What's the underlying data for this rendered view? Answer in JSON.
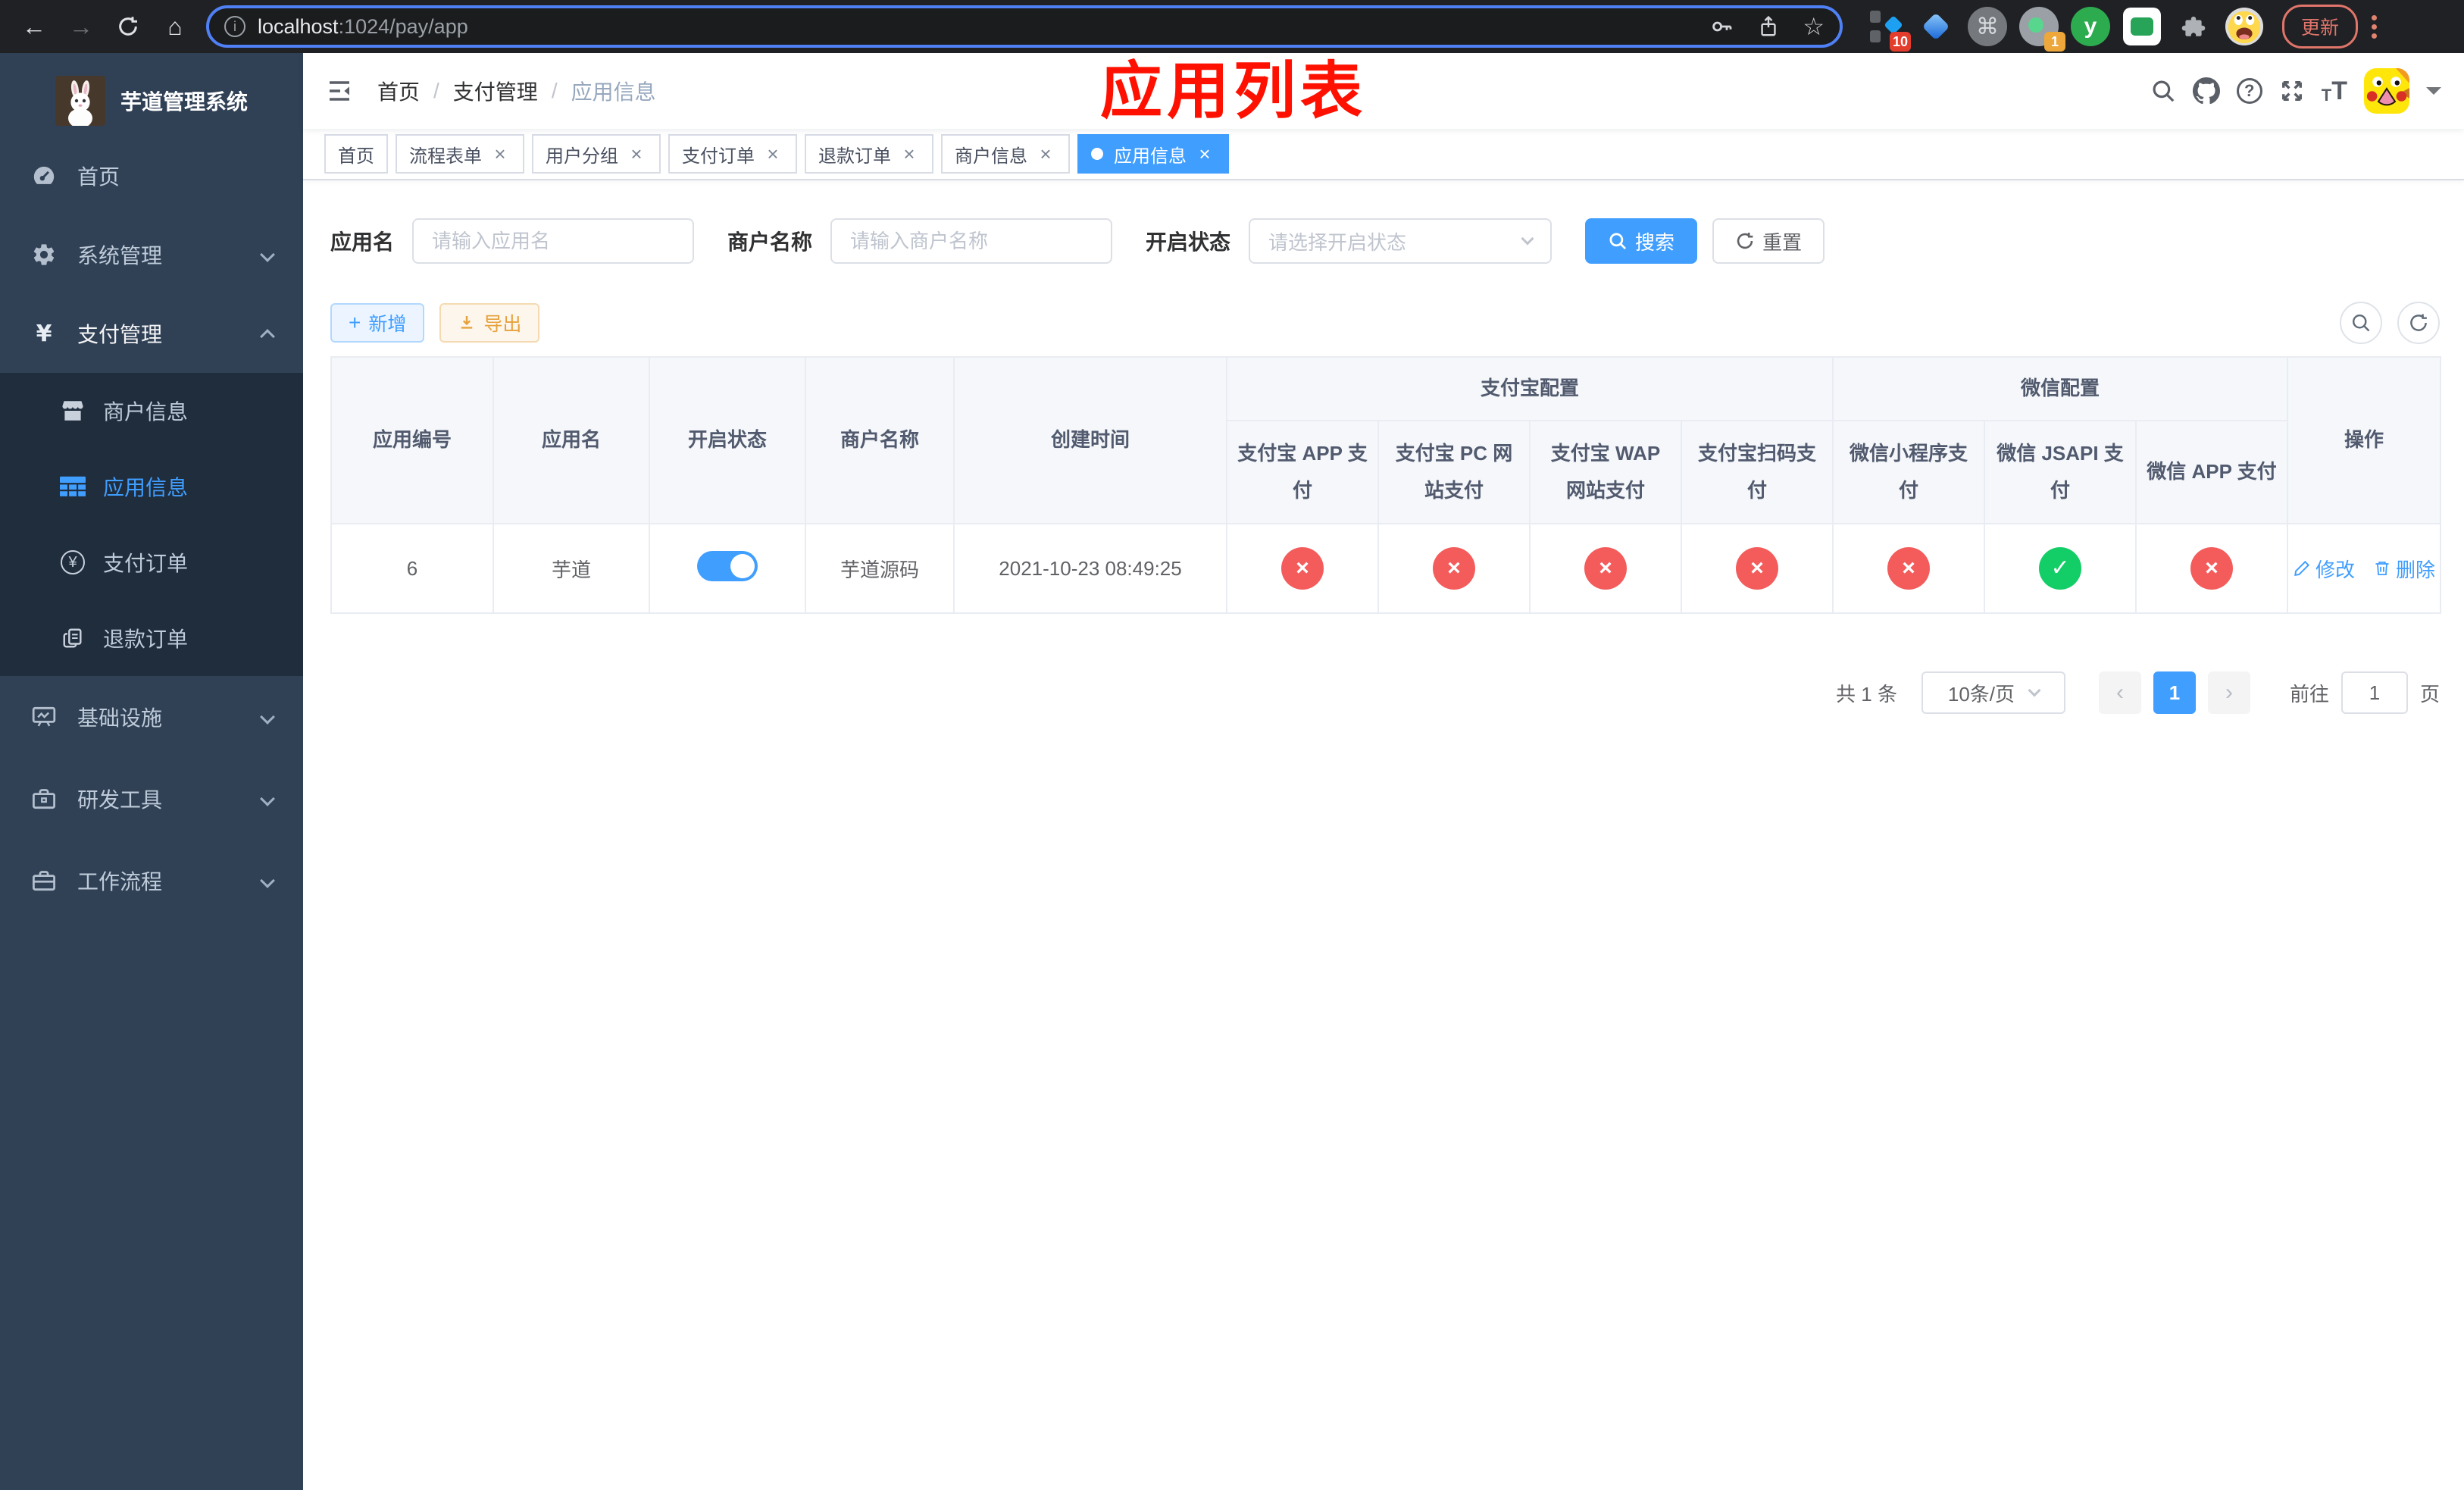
{
  "browser": {
    "url_domain": "localhost",
    "url_path": ":1024/pay/app",
    "update_label": "更新",
    "ext_badges": {
      "diamond": "10",
      "record": "1"
    },
    "ext_letter": "y"
  },
  "icons": {
    "back": "←",
    "forward": "→",
    "home": "⌂",
    "star": "☆",
    "command": "⌘",
    "info": "i",
    "question": "?",
    "yen": "¥",
    "plus": "+",
    "close": "×",
    "check": "✓",
    "cross": "×",
    "prev": "‹",
    "next": "›",
    "t_small": "T",
    "t_large": "T",
    "active_dot": ""
  },
  "sidebar": {
    "title": "芋道管理系统",
    "items": [
      {
        "label": "首页"
      },
      {
        "label": "系统管理"
      },
      {
        "label": "支付管理"
      },
      {
        "label": "商户信息"
      },
      {
        "label": "应用信息"
      },
      {
        "label": "支付订单"
      },
      {
        "label": "退款订单"
      },
      {
        "label": "基础设施"
      },
      {
        "label": "研发工具"
      },
      {
        "label": "工作流程"
      }
    ]
  },
  "header": {
    "breadcrumb": [
      "首页",
      "支付管理",
      "应用信息"
    ]
  },
  "annotation": {
    "title": "应用列表"
  },
  "tabs": [
    {
      "label": "首页"
    },
    {
      "label": "流程表单"
    },
    {
      "label": "用户分组"
    },
    {
      "label": "支付订单"
    },
    {
      "label": "退款订单"
    },
    {
      "label": "商户信息"
    },
    {
      "label": "应用信息"
    }
  ],
  "filters": {
    "app_name_label": "应用名",
    "app_name_placeholder": "请输入应用名",
    "merchant_label": "商户名称",
    "merchant_placeholder": "请输入商户名称",
    "status_label": "开启状态",
    "status_placeholder": "请选择开启状态",
    "search_label": "搜索",
    "reset_label": "重置"
  },
  "toolbar": {
    "add_label": "新增",
    "export_label": "导出"
  },
  "table": {
    "headers": {
      "app_id": "应用编号",
      "app_name": "应用名",
      "status": "开启状态",
      "merchant": "商户名称",
      "created": "创建时间",
      "alipay_group": "支付宝配置",
      "wechat_group": "微信配置",
      "alipay_app": "支付宝 APP 支付",
      "alipay_pc": "支付宝 PC 网站支付",
      "alipay_wap": "支付宝 WAP 网站支付",
      "alipay_qr": "支付宝扫码支付",
      "wechat_mini": "微信小程序支付",
      "wechat_jsapi": "微信 JSAPI 支付",
      "wechat_app": "微信 APP 支付",
      "actions": "操作"
    },
    "rows": [
      {
        "app_id": "6",
        "app_name": "芋道",
        "status_on": true,
        "merchant": "芋道源码",
        "created": "2021-10-23 08:49:25",
        "configs": [
          "no",
          "no",
          "no",
          "no",
          "no",
          "yes",
          "no"
        ],
        "edit_label": "修改",
        "delete_label": "删除"
      }
    ]
  },
  "pagination": {
    "total": "共 1 条",
    "page_size": "10条/页",
    "current_page": "1",
    "goto_label": "前往",
    "goto_value": "1",
    "page_suffix": "页"
  },
  "colors": {
    "accent": "#409eff",
    "success": "#13ce66",
    "danger": "#f45c5c",
    "warning": "#e6a23c"
  }
}
